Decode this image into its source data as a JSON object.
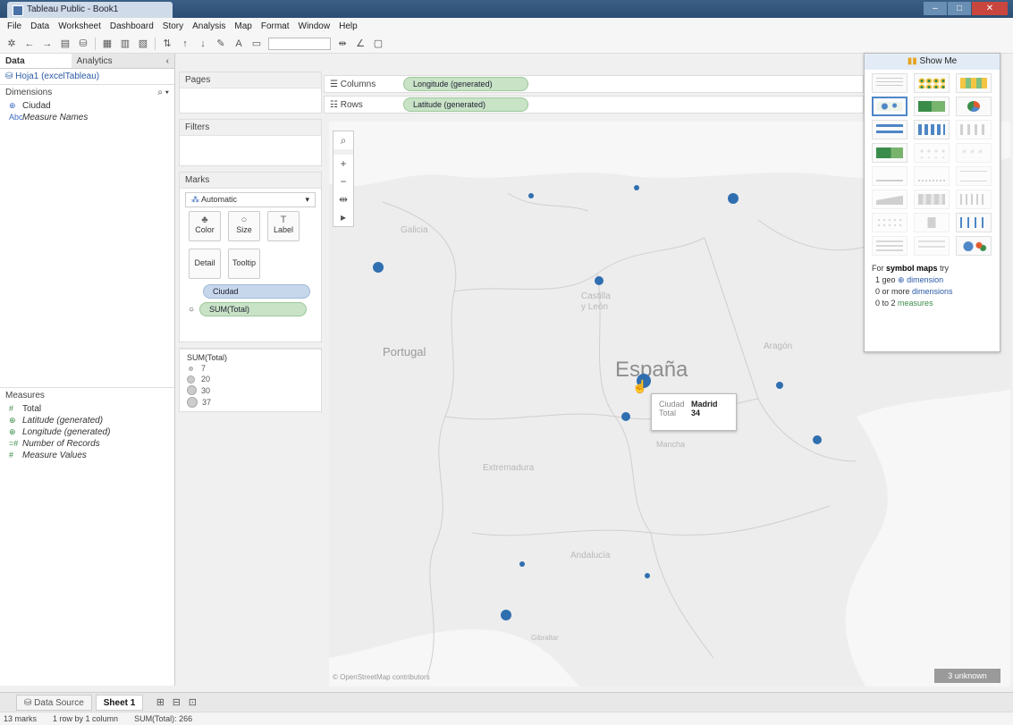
{
  "window": {
    "title": "Tableau Public - Book1"
  },
  "menu": [
    "File",
    "Data",
    "Worksheet",
    "Dashboard",
    "Story",
    "Analysis",
    "Map",
    "Format",
    "Window",
    "Help"
  ],
  "left_pane": {
    "tabs": {
      "data": "Data",
      "analytics": "Analytics"
    },
    "datasource": "Hoja1 (excelTableau)",
    "dimensions_header": "Dimensions",
    "dimensions": [
      "Ciudad",
      "Measure Names"
    ],
    "measures_header": "Measures",
    "measures": [
      "Total",
      "Latitude (generated)",
      "Longitude (generated)",
      "Number of Records",
      "Measure Values"
    ]
  },
  "shelves": {
    "pages": "Pages",
    "filters": "Filters",
    "marks": "Marks",
    "mark_type": "Automatic",
    "buttons": {
      "color": "Color",
      "size": "Size",
      "label": "Label",
      "detail": "Detail",
      "tooltip": "Tooltip"
    },
    "pills": {
      "ciudad": "Ciudad",
      "sum_total": "SUM(Total)"
    },
    "legend_title": "SUM(Total)",
    "legend_values": [
      "7",
      "20",
      "30",
      "37"
    ]
  },
  "columns": {
    "label": "Columns",
    "pill": "Longitude (generated)"
  },
  "rows": {
    "label": "Rows",
    "pill": "Latitude (generated)"
  },
  "map": {
    "labels": {
      "espana": "España",
      "portugal": "Portugal",
      "galicia": "Galicia",
      "castilla": "Castilla\ny León",
      "aragon": "Aragón",
      "extremadura": "Extremadura",
      "andalucia": "Andalucía",
      "mancha": "Mancha",
      "gibraltar": "Gibraltar"
    },
    "attribution": "© OpenStreetMap contributors",
    "unknown": "3 unknown",
    "dot_color": "#2f6fb0"
  },
  "tooltip": {
    "ciudad_key": "Ciudad",
    "ciudad_val": "Madrid",
    "total_key": "Total",
    "total_val": "34"
  },
  "show_me": {
    "title": "Show Me",
    "hint_pre": "For",
    "hint_bold": "symbol maps",
    "hint_post": "try",
    "line1_a": "1 geo",
    "line1_b": "dimension",
    "line2_a": "0 or more",
    "line2_b": "dimensions",
    "line3_a": "0 to 2",
    "line3_b": "measures"
  },
  "bottom_tabs": {
    "datasource": "Data Source",
    "sheet": "Sheet 1"
  },
  "status": {
    "marks": "13 marks",
    "rows": "1 row by 1 column",
    "sum": "SUM(Total): 266"
  }
}
